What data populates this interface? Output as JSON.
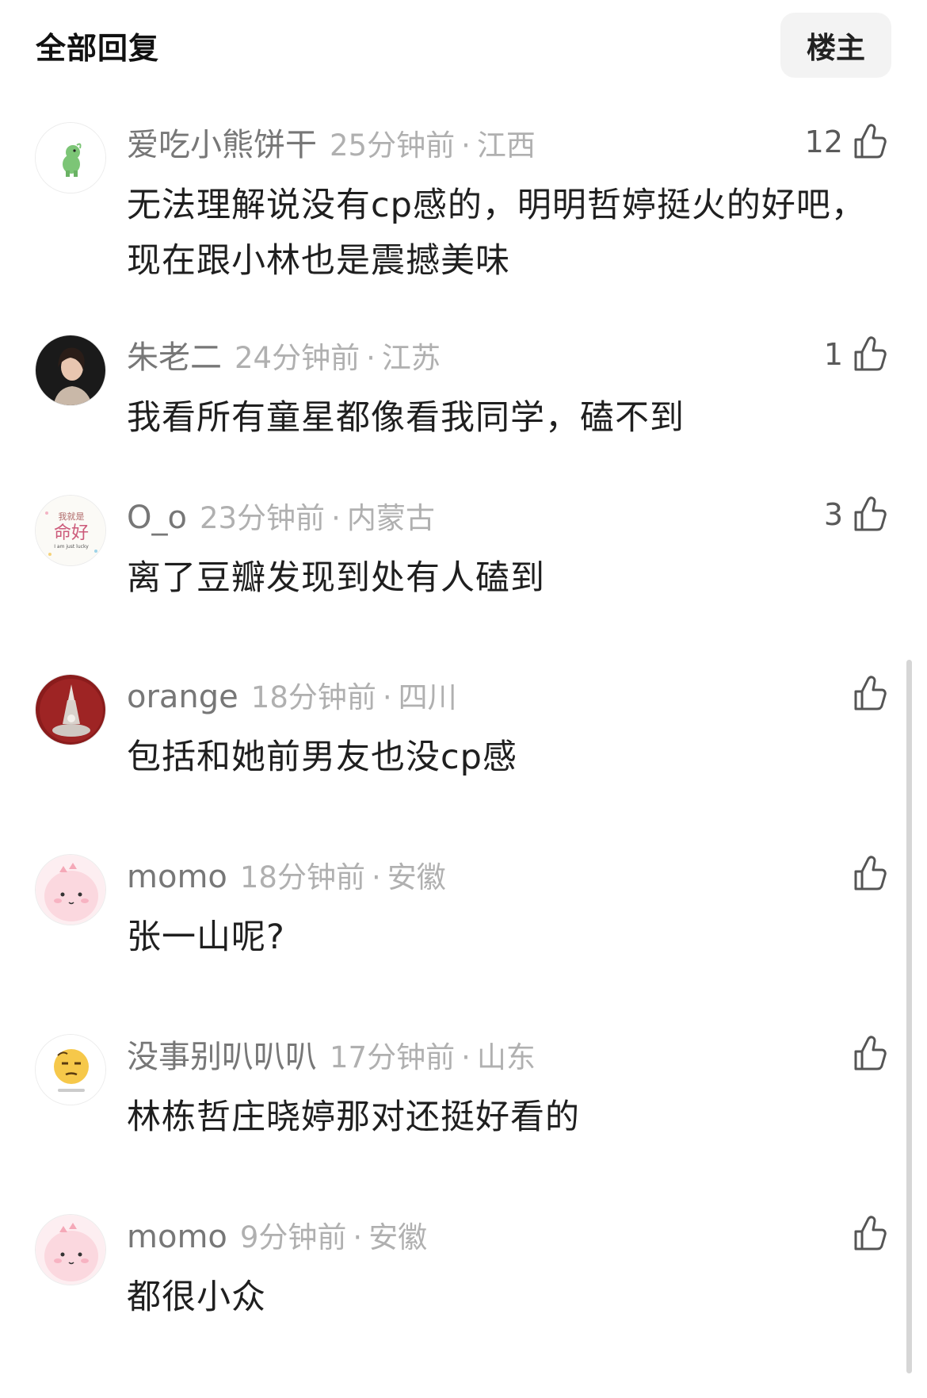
{
  "header": {
    "title": "全部回复",
    "op_button_label": "楼主"
  },
  "comments": [
    {
      "username": "爱吃小熊饼干",
      "time": "25分钟前",
      "separator": "·",
      "location": "江西",
      "likes": "12",
      "text": "无法理解说没有cp感的，明明哲婷挺火的好吧，现在跟小林也是震撼美味",
      "avatar": "green-dinosaur-avatar"
    },
    {
      "username": "朱老二",
      "time": "24分钟前",
      "separator": "·",
      "location": "江苏",
      "likes": "1",
      "text": "我看所有童星都像看我同学，磕不到",
      "avatar": "portrait-photo-avatar"
    },
    {
      "username": "O_o",
      "time": "23分钟前",
      "separator": "·",
      "location": "内蒙古",
      "likes": "3",
      "text": "离了豆瓣发现到处有人磕到",
      "avatar": "text-sticker-avatar",
      "avatar_text_top": "我就是",
      "avatar_text_main": "命好",
      "avatar_text_sub": "I am just lucky"
    },
    {
      "username": "orange",
      "time": "18分钟前",
      "separator": "·",
      "location": "四川",
      "likes": "",
      "text": "包括和她前男友也没cp感",
      "avatar": "red-tower-avatar"
    },
    {
      "username": "momo",
      "time": "18分钟前",
      "separator": "·",
      "location": "安徽",
      "likes": "",
      "text": "张一山呢?",
      "avatar": "pink-dino-avatar"
    },
    {
      "username": "没事别叭叭叭",
      "time": "17分钟前",
      "separator": "·",
      "location": "山东",
      "likes": "",
      "text": "林栋哲庄晓婷那对还挺好看的",
      "avatar": "sleepy-emoji-avatar"
    },
    {
      "username": "momo",
      "time": "9分钟前",
      "separator": "·",
      "location": "安徽",
      "likes": "",
      "text": "都很小众",
      "avatar": "pink-dino-avatar"
    }
  ],
  "colors": {
    "username": "#777777",
    "meta": "#b0b0b0",
    "body": "#1f1f1f",
    "op_button_bg": "#f3f3f3"
  }
}
